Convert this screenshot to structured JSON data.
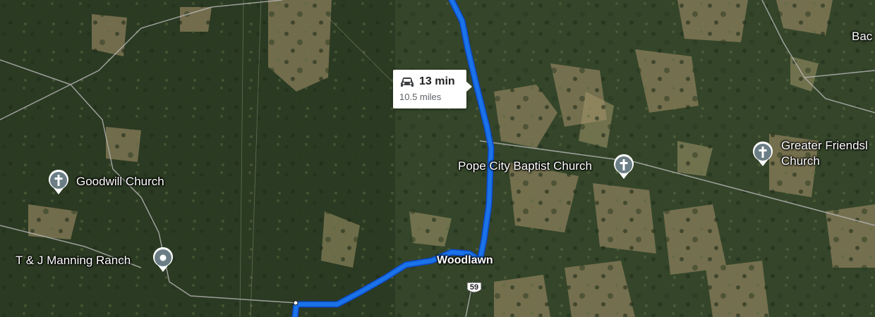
{
  "colors": {
    "route": "#1a73e8",
    "route_outline": "#0b48c9",
    "pin": "#6b7e86",
    "road": "#b8b8b8"
  },
  "route_info": {
    "icon": "car-icon",
    "duration": "13 min",
    "distance": "10.5 miles"
  },
  "places": {
    "goodwill": "Goodwill Church",
    "pope_city": "Pope City Baptist Church",
    "greater_friends_line1": "Greater Friendsl",
    "greater_friends_line2": "Church",
    "manning": "T & J Manning Ranch",
    "woodlawn": "Woodlawn",
    "bac": "Bac"
  },
  "highway": {
    "number": "59"
  }
}
